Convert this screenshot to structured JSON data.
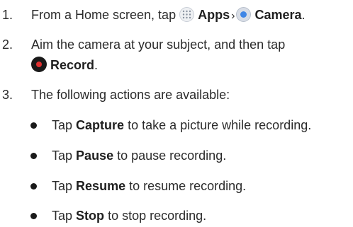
{
  "steps": [
    {
      "number": "1.",
      "prefix": "From a Home screen, tap",
      "apps_label": "Apps",
      "separator": "›",
      "camera_label": "Camera",
      "end": ".",
      "apps_icon": "apps-grid-icon",
      "camera_icon": "camera-app-icon"
    },
    {
      "number": "2.",
      "line1": "Aim the camera at your subject, and then tap",
      "record_label": "Record",
      "end": ".",
      "record_icon": "record-button-icon"
    },
    {
      "number": "3.",
      "text": "The following actions are available:"
    }
  ],
  "bullets": [
    {
      "tap": "Tap",
      "action": "Capture",
      "rest": "to take a picture while recording."
    },
    {
      "tap": "Tap",
      "action": "Pause",
      "rest": "to pause recording."
    },
    {
      "tap": "Tap",
      "action": "Resume",
      "rest": "to resume recording."
    },
    {
      "tap": "Tap",
      "action": "Stop",
      "rest": "to stop recording."
    }
  ]
}
